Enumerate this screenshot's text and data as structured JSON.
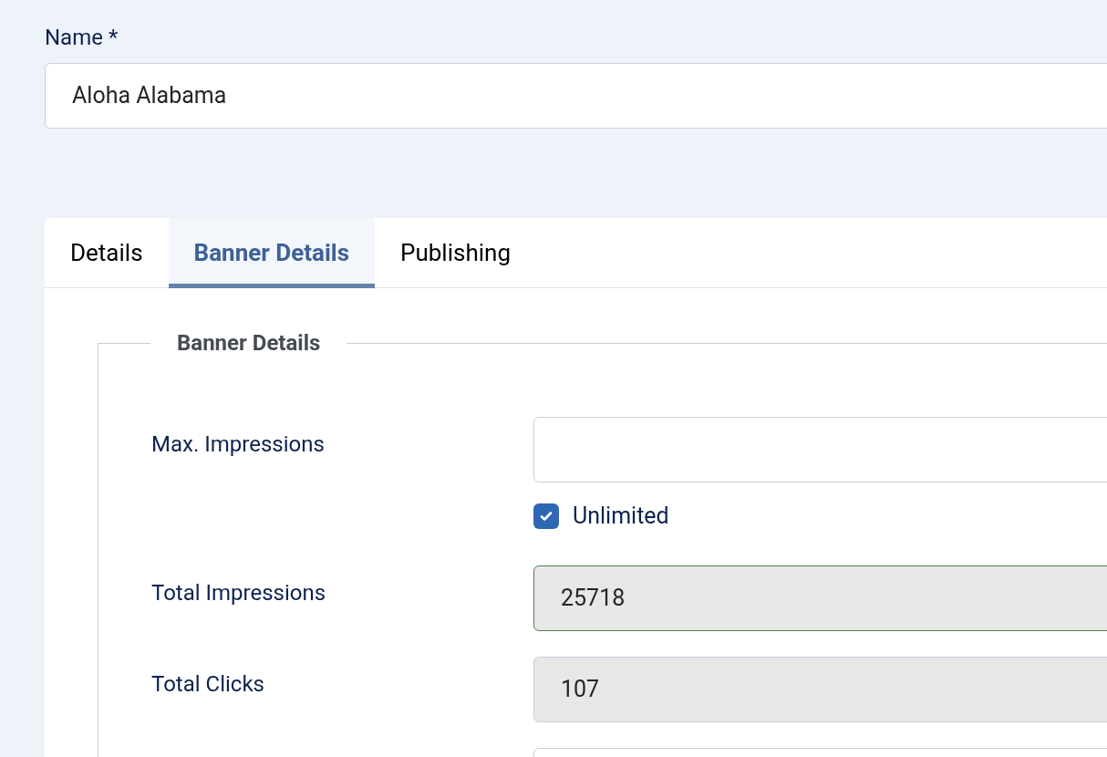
{
  "name_field": {
    "label": "Name *",
    "value": "Aloha Alabama"
  },
  "tabs": [
    {
      "label": "Details",
      "selected": false
    },
    {
      "label": "Banner Details",
      "selected": true
    },
    {
      "label": "Publishing",
      "selected": false
    }
  ],
  "fieldset": {
    "legend": "Banner Details",
    "rows": [
      {
        "kind": "field",
        "label": "Max. Impressions",
        "disabled": false,
        "valid": false
      },
      {
        "kind": "checkbox",
        "label": "Unlimited",
        "checked": true
      },
      {
        "kind": "field",
        "label": "Total Impressions",
        "value": "25718",
        "disabled": true,
        "valid": true
      },
      {
        "kind": "field",
        "label": "Total Clicks",
        "value": "107",
        "disabled": true,
        "valid": false
      },
      {
        "kind": "field",
        "disabled": false,
        "valid": false
      }
    ]
  }
}
